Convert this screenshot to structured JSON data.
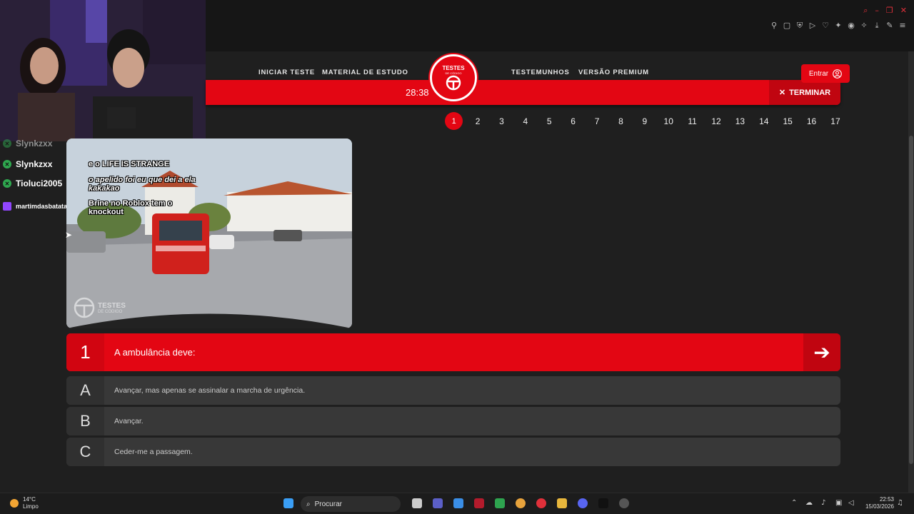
{
  "nav": {
    "links": [
      "INICIAR TESTE",
      "MATERIAL DE ESTUDO",
      "TESTEMUNHOS",
      "VERSÃO PREMIUM"
    ],
    "logo_title": "TESTES",
    "logo_sub": "DE CÓDIGO",
    "login_label": "Entrar"
  },
  "quiz_bar": {
    "timer": "28:38",
    "finish_label": "TERMINAR"
  },
  "pager": {
    "pages": [
      "1",
      "2",
      "3",
      "4",
      "5",
      "6",
      "7",
      "8",
      "9",
      "10",
      "11",
      "12",
      "13",
      "14",
      "15",
      "16",
      "17"
    ],
    "current": "1"
  },
  "chat": {
    "users": [
      "Slynkzxx",
      "Slynkzxx",
      "Tioluci2005",
      "martimdasbatatass"
    ]
  },
  "video_overlay": {
    "lines": [
      "e o LIFE IS STRANGE",
      "o apelido foi eu que dei a ela kakakao",
      "Brine no Roblox tem o knockout"
    ],
    "watermark": "TESTES",
    "watermark_sub": "DE CÓDIGO"
  },
  "question": {
    "number": "1",
    "text": "A ambulância deve:"
  },
  "answers": [
    {
      "letter": "A",
      "text": "Avançar, mas apenas se assinalar a marcha de urgência."
    },
    {
      "letter": "B",
      "text": "Avançar."
    },
    {
      "letter": "C",
      "text": "Ceder-me a passagem."
    }
  ],
  "taskbar": {
    "temperature": "14°C",
    "weather": "Limpo",
    "search_placeholder": "Procurar",
    "time": "22:53",
    "date": "15/03/2026"
  },
  "colors": {
    "brand_red": "#e30613",
    "background": "#1f1f1f"
  }
}
